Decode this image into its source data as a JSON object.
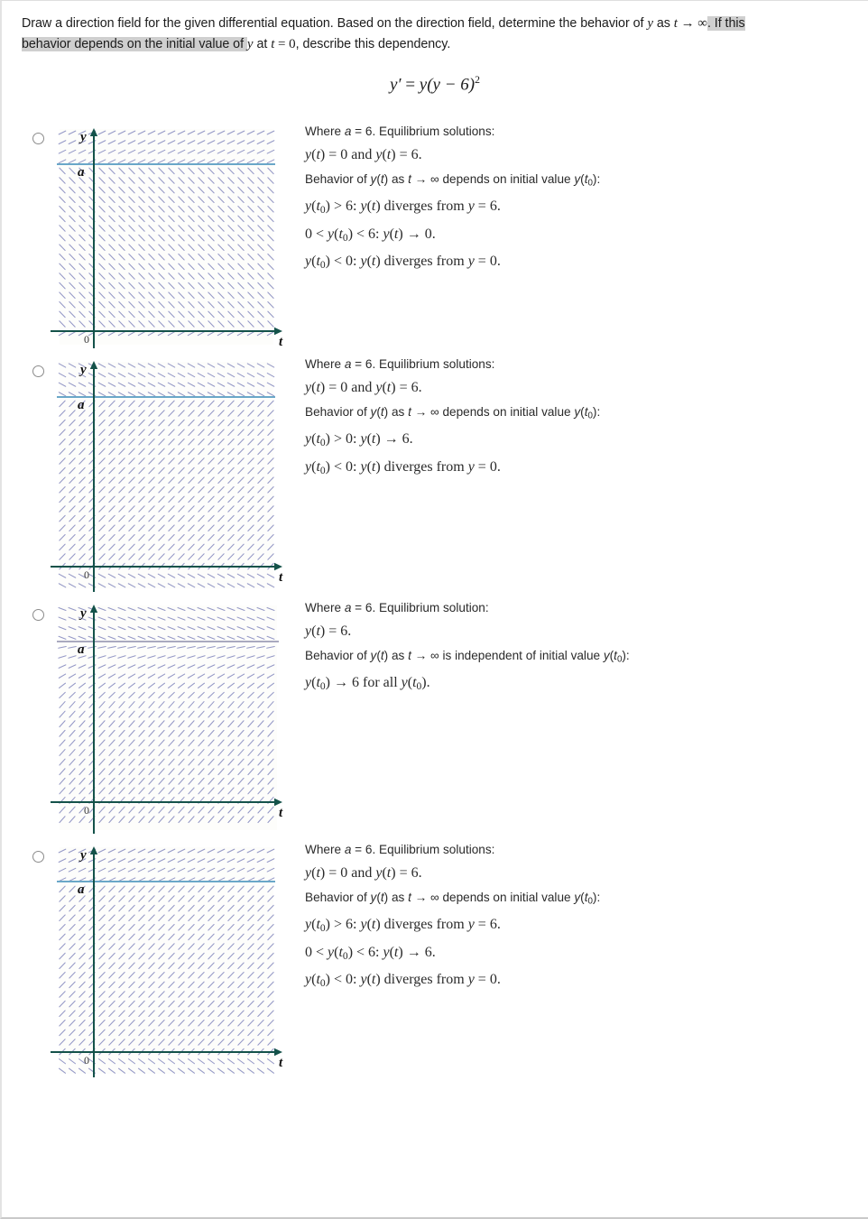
{
  "question": {
    "line1_pre": "Draw a direction field for the given differential equation. Based on the direction field, determine the behavior of ",
    "line1_y": "y",
    "line1_as": " as ",
    "line1_t": "t",
    "line1_arrow": " → ",
    "line1_inf": "∞",
    "line1_hl": ". If this",
    "line2_hl": "behavior depends on the initial value of ",
    "line2_y": "y",
    "line2_at": " at ",
    "line2_t": "t",
    "line2_eq": " = 0",
    "line2_tail": ", describe this dependency.",
    "equation": "y′ = y(y − 6)²",
    "equation_parts": {
      "lhs": "y′",
      "eq": "=",
      "rhs_base": "y(y − 6)",
      "rhs_exp": "2"
    }
  },
  "axis_labels": {
    "y": "y",
    "t": "t",
    "origin": "0",
    "equilibrium": "a"
  },
  "colors": {
    "axis": "#14524a",
    "equilibrium_blue": "#6aa7c8",
    "equilibrium_gray": "#a9a9bf",
    "slope": "#8f93c4",
    "highlight": "#cfcfcf",
    "radio_border": "#8b8b8b",
    "text": "#1c1c1c"
  },
  "chart_data": {
    "type": "line",
    "title": "Direction fields for y' = y(y-6)^2",
    "xlabel": "t",
    "ylabel": "y",
    "equilibria_values": [
      0,
      6
    ],
    "a_value": 6,
    "plots": [
      {
        "id": "field-a",
        "equilibrium_line_color": "#6aa7c8",
        "regions": [
          {
            "name": "above-a",
            "slope_sign": "positive",
            "description": "arrows point up-right above y = a"
          },
          {
            "name": "between-0-and-a",
            "slope_sign": "negative",
            "description": "arrows point down-right between y = 0 and y = a"
          },
          {
            "name": "below-0",
            "slope_sign": "positive",
            "description": "arrows point up-right below y = 0"
          }
        ]
      },
      {
        "id": "field-b",
        "equilibrium_line_color": "#6aa7c8",
        "regions": [
          {
            "name": "above-a",
            "slope_sign": "negative",
            "description": "arrows point down-right above y = a"
          },
          {
            "name": "between-0-and-a",
            "slope_sign": "positive",
            "description": "arrows point up-right between y = 0 and y = a"
          },
          {
            "name": "below-0",
            "slope_sign": "negative",
            "description": "arrows point down-right below y = 0"
          }
        ]
      },
      {
        "id": "field-c",
        "equilibrium_line_color": "#a9a9bf",
        "regions": [
          {
            "name": "above-a",
            "slope_sign": "negative",
            "description": "arrows point down-right above y = a"
          },
          {
            "name": "below-a",
            "slope_sign": "positive",
            "description": "arrows point up-right below y = a, everywhere converging to a"
          }
        ]
      },
      {
        "id": "field-d",
        "equilibrium_line_color": "#6aa7c8",
        "regions": [
          {
            "name": "above-a",
            "slope_sign": "positive",
            "description": "arrows point up-right above y = a"
          },
          {
            "name": "between-0-and-a",
            "slope_sign": "positive",
            "description": "arrows point up-right between y = 0 and y = a"
          },
          {
            "name": "below-0",
            "slope_sign": "negative",
            "description": "arrows point down-right below y = 0"
          }
        ]
      }
    ]
  },
  "options": [
    {
      "id": "option-a",
      "selected": false,
      "lines": [
        {
          "style": "sans",
          "html": "Where <i>a</i> = 6. Equilibrium solutions:"
        },
        {
          "style": "serif",
          "html": "<i>y</i>(<i>t</i>) = 0 and <i>y</i>(<i>t</i>) = 6."
        },
        {
          "style": "sans",
          "html": "Behavior of <i>y</i>(<i>t</i>) as <i>t</i> &#8594; &#8734; depends on initial value <i>y</i>(<i>t</i><span class=\"sub\">0</span>):"
        },
        {
          "style": "serif",
          "html": "<i>y</i>(<i>t</i><span class=\"sub\">0</span>) > 6: <i>y</i>(<i>t</i>) diverges from <i>y</i> = 6."
        },
        {
          "style": "serif",
          "html": "0 < <i>y</i>(<i>t</i><span class=\"sub\">0</span>) < 6: <i>y</i>(<i>t</i>) &#8594; 0."
        },
        {
          "style": "serif",
          "html": "<i>y</i>(<i>t</i><span class=\"sub\">0</span>) < 0: <i>y</i>(<i>t</i>) diverges from <i>y</i> = 0."
        }
      ],
      "plain_text": [
        "Where a = 6. Equilibrium solutions:",
        "y(t) = 0 and y(t) = 6.",
        "Behavior of y(t) as t → ∞ depends on initial value y(t0):",
        "y(t0) > 6: y(t) diverges from y = 6.",
        "0 < y(t0) < 6: y(t) → 0.",
        "y(t0) < 0: y(t) diverges from y = 0."
      ]
    },
    {
      "id": "option-b",
      "selected": false,
      "lines": [
        {
          "style": "sans",
          "html": "Where <i>a</i> = 6. Equilibrium solutions:"
        },
        {
          "style": "serif",
          "html": "<i>y</i>(<i>t</i>) = 0 and <i>y</i>(<i>t</i>) = 6."
        },
        {
          "style": "sans",
          "html": "Behavior of <i>y</i>(<i>t</i>) as <i>t</i> &#8594; &#8734; depends on initial value <i>y</i>(<i>t</i><span class=\"sub\">0</span>):"
        },
        {
          "style": "serif",
          "html": "<i>y</i>(<i>t</i><span class=\"sub\">0</span>) > 0: <i>y</i>(<i>t</i>) &#8594; 6."
        },
        {
          "style": "serif",
          "html": "<i>y</i>(<i>t</i><span class=\"sub\">0</span>) < 0: <i>y</i>(<i>t</i>) diverges from <i>y</i> = 0."
        }
      ],
      "plain_text": [
        "Where a = 6. Equilibrium solutions:",
        "y(t) = 0 and y(t) = 6.",
        "Behavior of y(t) as t → ∞ depends on initial value y(t0):",
        "y(t0) > 0: y(t) → 6.",
        "y(t0) < 0: y(t) diverges from y = 0."
      ]
    },
    {
      "id": "option-c",
      "selected": false,
      "lines": [
        {
          "style": "sans",
          "html": "Where <i>a</i> = 6. Equilibrium solution:"
        },
        {
          "style": "serif",
          "html": "<i>y</i>(<i>t</i>) = 6."
        },
        {
          "style": "sans",
          "html": "Behavior of <i>y</i>(<i>t</i>) as <i>t</i> &#8594; &#8734; is independent of initial value <i>y</i>(<i>t</i><span class=\"sub\">0</span>):"
        },
        {
          "style": "serif",
          "html": "<i>y</i>(<i>t</i><span class=\"sub\">0</span>) &#8594; 6 for all <i>y</i>(<i>t</i><span class=\"sub\">0</span>)."
        }
      ],
      "plain_text": [
        "Where a = 6. Equilibrium solution:",
        "y(t) = 6.",
        "Behavior of y(t) as t → ∞ is independent of initial value y(t0):",
        "y(t0) → 6 for all y(t0)."
      ]
    },
    {
      "id": "option-d",
      "selected": false,
      "lines": [
        {
          "style": "sans",
          "html": "Where <i>a</i> = 6. Equilibrium solutions:"
        },
        {
          "style": "serif",
          "html": "<i>y</i>(<i>t</i>) = 0 and <i>y</i>(<i>t</i>) = 6."
        },
        {
          "style": "sans",
          "html": "Behavior of <i>y</i>(<i>t</i>) as <i>t</i> &#8594; &#8734; depends on initial value <i>y</i>(<i>t</i><span class=\"sub\">0</span>):"
        },
        {
          "style": "serif",
          "html": "<i>y</i>(<i>t</i><span class=\"sub\">0</span>) > 6: <i>y</i>(<i>t</i>) diverges from <i>y</i> = 6."
        },
        {
          "style": "serif",
          "html": "0 < <i>y</i>(<i>t</i><span class=\"sub\">0</span>) < 6: <i>y</i>(<i>t</i>) &#8594; 6."
        },
        {
          "style": "serif",
          "html": "<i>y</i>(<i>t</i><span class=\"sub\">0</span>) < 0: <i>y</i>(<i>t</i>) diverges from <i>y</i> = 0."
        }
      ],
      "plain_text": [
        "Where a = 6. Equilibrium solutions:",
        "y(t) = 0 and y(t) = 6.",
        "Behavior of y(t) as t → ∞ depends on initial value y(t0):",
        "y(t0) > 6: y(t) diverges from y = 6.",
        "0 < y(t0) < 6: y(t) → 6.",
        "y(t0) < 0: y(t) diverges from y = 0."
      ]
    }
  ]
}
